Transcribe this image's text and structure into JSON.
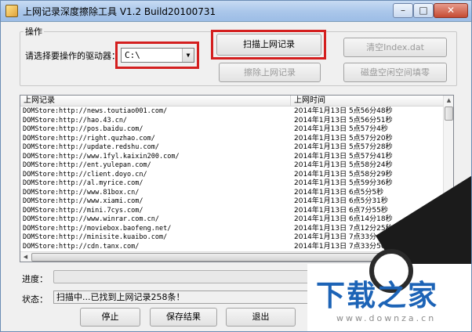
{
  "window": {
    "title": "上网记录深度擦除工具 V1.2   Build20100731",
    "minimize_glyph": "–",
    "maximize_glyph": "□",
    "close_glyph": "✕"
  },
  "operation": {
    "group_label": "操作",
    "drive_label": "请选择要操作的驱动器：",
    "drive_value": "C:\\",
    "scan_button": "扫描上网记录",
    "erase_button": "擦除上网记录",
    "clear_index_button": "清空Index.dat",
    "wipe_free_space_button": "磁盘空闲空间填零"
  },
  "list": {
    "columns": [
      "上网记录",
      "上网时间"
    ],
    "rows": [
      {
        "url": "DOMStore:http://news.toutiao001.com/",
        "time": "2014年1月13日  5点56分48秒"
      },
      {
        "url": "DOMStore:http://hao.43.cn/",
        "time": "2014年1月13日  5点56分51秒"
      },
      {
        "url": "DOMStore:http://pos.baidu.com/",
        "time": "2014年1月13日  5点57分4秒"
      },
      {
        "url": "DOMStore:http://right.quzhao.com/",
        "time": "2014年1月13日  5点57分20秒"
      },
      {
        "url": "DOMStore:http://update.redshu.com/",
        "time": "2014年1月13日  5点57分28秒"
      },
      {
        "url": "DOMStore:http://www.1fyl.kaixin200.com/",
        "time": "2014年1月13日  5点57分41秒"
      },
      {
        "url": "DOMStore:http://ent.yulepan.com/",
        "time": "2014年1月13日  5点58分24秒"
      },
      {
        "url": "DOMStore:http://client.doyo.cn/",
        "time": "2014年1月13日  5点58分29秒"
      },
      {
        "url": "DOMStore:http://al.myrice.com/",
        "time": "2014年1月13日  5点59分36秒"
      },
      {
        "url": "DOMStore:http://www.81box.cn/",
        "time": "2014年1月13日  6点5分5秒"
      },
      {
        "url": "DOMStore:http://www.xiami.com/",
        "time": "2014年1月13日  6点5分31秒"
      },
      {
        "url": "DOMStore:http://mini.7cys.com/",
        "time": "2014年1月13日  6点7分55秒"
      },
      {
        "url": "DOMStore:http://www.winrar.com.cn/",
        "time": "2014年1月13日  6点14分18秒"
      },
      {
        "url": "DOMStore:http://moviebox.baofeng.net/",
        "time": "2014年1月13日  7点12分25秒"
      },
      {
        "url": "DOMStore:http://minisite.kuaibo.com/",
        "time": "2014年1月13日  7点33分49秒"
      },
      {
        "url": "DOMStore:http://cdn.tanx.com/",
        "time": "2014年1月13日  7点33分50秒"
      }
    ]
  },
  "progress": {
    "label": "进度：",
    "value": 0
  },
  "status": {
    "label": "状态：",
    "text": "扫描中...已找到上网记录258条！"
  },
  "buttons": {
    "stop": "停止",
    "save_results": "保存结果",
    "exit": "退出"
  },
  "watermark": {
    "logo": "下载之家",
    "url": "www.downza.cn"
  }
}
